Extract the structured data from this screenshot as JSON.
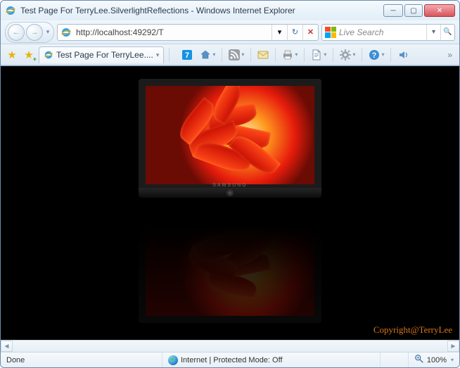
{
  "window": {
    "title": "Test Page For TerryLee.SilverlightReflections - Windows Internet Explorer"
  },
  "nav": {
    "url": "http://localhost:49292/T",
    "search_placeholder": "Live Search"
  },
  "tabs": {
    "active_label": "Test Page For TerryLee...."
  },
  "toolbar_icons": {
    "seven": "7",
    "home": "home-icon",
    "rss": "rss-icon",
    "mail": "mail-icon",
    "print": "print-icon",
    "page": "page-icon",
    "tools": "tools-icon",
    "help": "help-icon",
    "audio": "audio-icon"
  },
  "content": {
    "tv_brand": "SAMSUNG",
    "copyright": "Copyright@TerryLee"
  },
  "status": {
    "left": "Done",
    "security": "Internet | Protected Mode: Off",
    "zoom": "100%"
  }
}
